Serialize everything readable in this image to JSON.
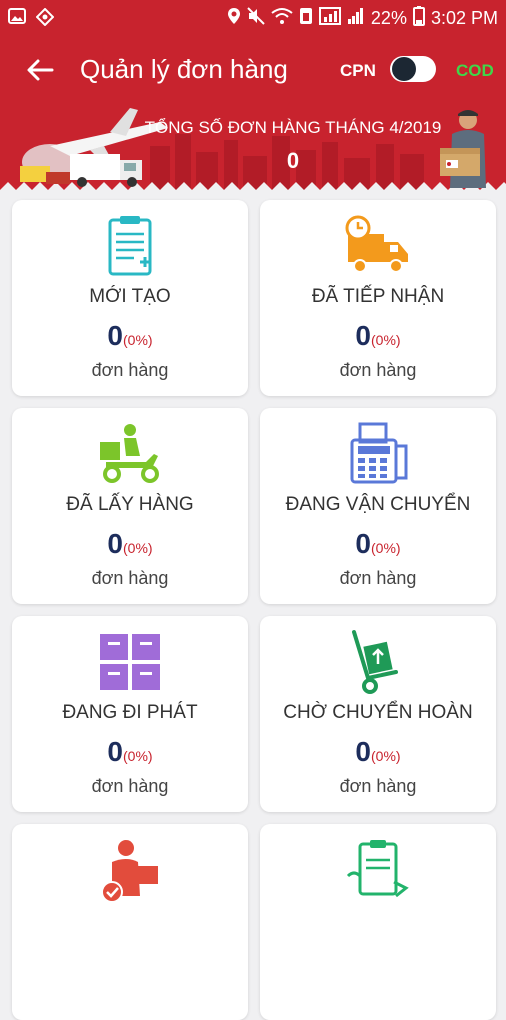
{
  "status_bar": {
    "battery": "22%",
    "time": "3:02 PM"
  },
  "app_bar": {
    "title": "Quản lý đơn hàng",
    "cpn_label": "CPN",
    "cod_label": "COD",
    "toggle_state": "off"
  },
  "banner": {
    "total_label": "TỔNG SỐ ĐƠN HÀNG THÁNG 4/2019",
    "total_value": "0"
  },
  "cards": [
    {
      "label": "MỚI TẠO",
      "count": "0",
      "percent": "(0%)",
      "unit": "đơn hàng",
      "icon": "clipboard-new-icon",
      "color": "#29b8c4"
    },
    {
      "label": "ĐÃ TIẾP NHẬN",
      "count": "0",
      "percent": "(0%)",
      "unit": "đơn hàng",
      "icon": "delivery-truck-icon",
      "color": "#f39a1c"
    },
    {
      "label": "ĐÃ LẤY HÀNG",
      "count": "0",
      "percent": "(0%)",
      "unit": "đơn hàng",
      "icon": "scooter-courier-icon",
      "color": "#7cc52a"
    },
    {
      "label": "ĐANG VẬN CHUYỂN",
      "count": "0",
      "percent": "(0%)",
      "unit": "đơn hàng",
      "icon": "fax-machine-icon",
      "color": "#5a78d8"
    },
    {
      "label": "ĐANG ĐI PHÁT",
      "count": "0",
      "percent": "(0%)",
      "unit": "đơn hàng",
      "icon": "stacked-boxes-icon",
      "color": "#a06cd8"
    },
    {
      "label": "CHỜ CHUYỂN HOÀN",
      "count": "0",
      "percent": "(0%)",
      "unit": "đơn hàng",
      "icon": "hand-truck-icon",
      "color": "#1f9a57"
    },
    {
      "label": "",
      "count": "",
      "percent": "",
      "unit": "",
      "icon": "person-delivered-icon",
      "color": "#e24c3c"
    },
    {
      "label": "",
      "count": "",
      "percent": "",
      "unit": "",
      "icon": "clipboard-return-icon",
      "color": "#22b36b"
    }
  ]
}
